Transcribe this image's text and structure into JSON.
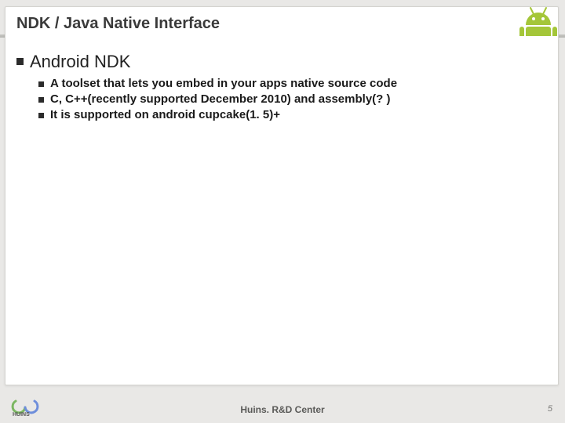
{
  "slide": {
    "title": "NDK / Java Native Interface",
    "section": "Android NDK",
    "bullets": [
      "A toolset that lets you embed in your apps native source code",
      "C, C++(recently supported December 2010) and assembly(? )",
      "It is supported on android cupcake(1. 5)+"
    ]
  },
  "footer": {
    "center": "Huins. R&D Center",
    "page": "5"
  },
  "icons": {
    "corner": "android-mascot",
    "logo": "huins-logo"
  },
  "colors": {
    "android": "#a4c639",
    "logo_accent1": "#7bb661",
    "logo_accent2": "#6e8edb"
  }
}
